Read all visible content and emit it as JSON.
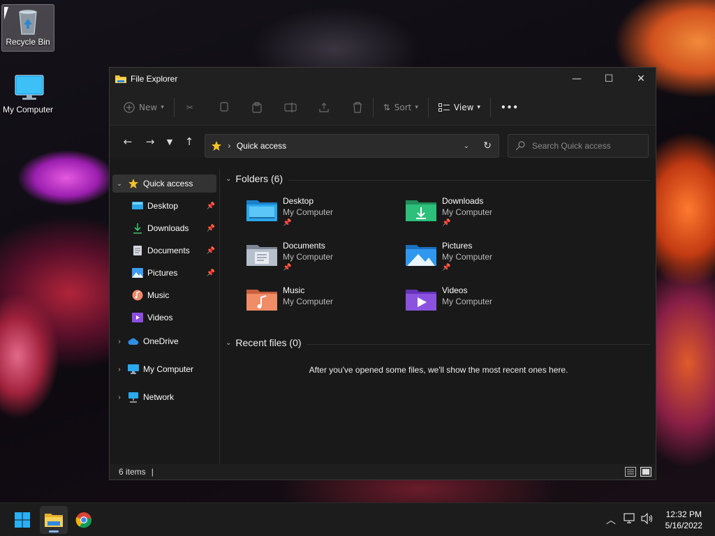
{
  "desktop": {
    "icons": [
      {
        "label": "Recycle Bin",
        "icon": "recycle-bin-icon"
      },
      {
        "label": "My Computer",
        "icon": "monitor-icon"
      }
    ]
  },
  "window": {
    "title": "File Explorer",
    "controls": {
      "minimize": "—",
      "maximize": "☐",
      "close": "✕"
    }
  },
  "toolbar": {
    "new_label": "New",
    "sort_label": "Sort",
    "view_label": "View",
    "more_label": "•••"
  },
  "navigation": {
    "address": "Quick access",
    "address_separator": "›",
    "search_placeholder": "Search Quick access"
  },
  "sidebar": {
    "quick_access": "Quick access",
    "children": [
      {
        "label": "Desktop",
        "icon": "desktop-folder-icon",
        "pinned": true
      },
      {
        "label": "Downloads",
        "icon": "download-icon",
        "pinned": true
      },
      {
        "label": "Documents",
        "icon": "documents-icon",
        "pinned": true
      },
      {
        "label": "Pictures",
        "icon": "pictures-icon",
        "pinned": true
      },
      {
        "label": "Music",
        "icon": "music-icon",
        "pinned": false
      },
      {
        "label": "Videos",
        "icon": "videos-icon",
        "pinned": false
      }
    ],
    "roots": [
      {
        "label": "OneDrive",
        "icon": "cloud-icon"
      },
      {
        "label": "My Computer",
        "icon": "monitor-icon"
      },
      {
        "label": "Network",
        "icon": "network-icon"
      }
    ]
  },
  "content": {
    "folders_heading": "Folders (6)",
    "folders": [
      {
        "name": "Desktop",
        "location": "My Computer",
        "pinned": true,
        "icon": "desktop-folder-icon"
      },
      {
        "name": "Downloads",
        "location": "My Computer",
        "pinned": true,
        "icon": "downloads-folder-icon"
      },
      {
        "name": "Documents",
        "location": "My Computer",
        "pinned": true,
        "icon": "documents-folder-icon"
      },
      {
        "name": "Pictures",
        "location": "My Computer",
        "pinned": true,
        "icon": "pictures-folder-icon"
      },
      {
        "name": "Music",
        "location": "My Computer",
        "pinned": false,
        "icon": "music-folder-icon"
      },
      {
        "name": "Videos",
        "location": "My Computer",
        "pinned": false,
        "icon": "videos-folder-icon"
      }
    ],
    "recent_heading": "Recent files (0)",
    "recent_empty": "After you've opened some files, we'll show the most recent ones here."
  },
  "status": {
    "items": "6 items"
  },
  "taskbar": {
    "time": "12:32 PM",
    "date": "5/16/2022"
  },
  "colors": {
    "accent": "#0078d4",
    "star": "#f7c325",
    "window_bg": "#191919"
  }
}
